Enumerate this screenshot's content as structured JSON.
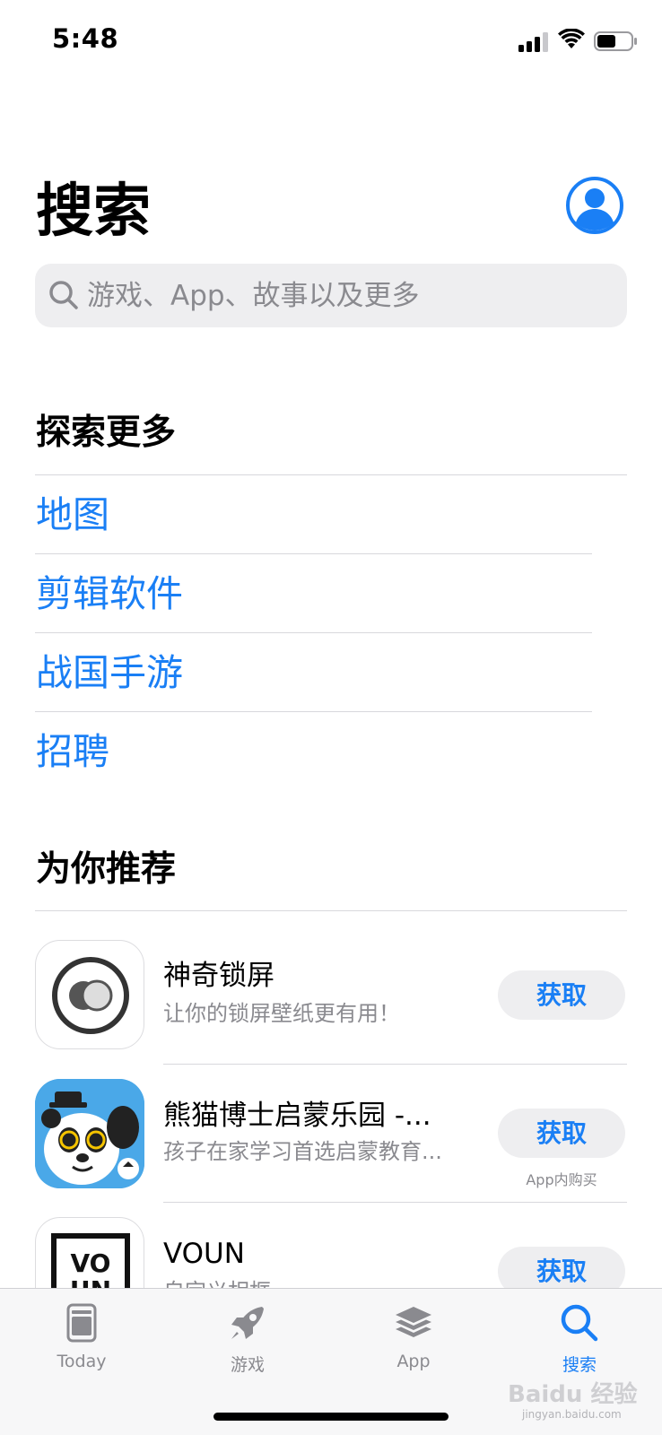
{
  "status_bar": {
    "time": "5:48"
  },
  "header": {
    "title": "搜索"
  },
  "search": {
    "placeholder": "游戏、App、故事以及更多"
  },
  "explore": {
    "title": "探索更多",
    "items": [
      "地图",
      "剪辑软件",
      "战国手游",
      "招聘"
    ]
  },
  "recommend": {
    "title": "为你推荐",
    "apps": [
      {
        "name": "神奇锁屏",
        "subtitle": "让你的锁屏壁纸更有用！",
        "button": "获取",
        "note": ""
      },
      {
        "name": "熊猫博士启蒙乐园 -...",
        "subtitle": "孩子在家学习首选启蒙教育...",
        "button": "获取",
        "note": "App内购买"
      },
      {
        "name": "VOUN",
        "subtitle": "自定义相框",
        "button": "获取",
        "note": ""
      }
    ]
  },
  "tabs": [
    {
      "label": "Today",
      "icon": "today-icon"
    },
    {
      "label": "游戏",
      "icon": "rocket-icon"
    },
    {
      "label": "App",
      "icon": "layers-icon"
    },
    {
      "label": "搜索",
      "icon": "search-icon",
      "active": true
    }
  ],
  "watermark": {
    "text": "Baidu 经验",
    "url": "jingyan.baidu.com"
  },
  "colors": {
    "accent": "#1a7ff5",
    "secondary_text": "#8a8a8f",
    "search_bg": "#eeeef0"
  }
}
